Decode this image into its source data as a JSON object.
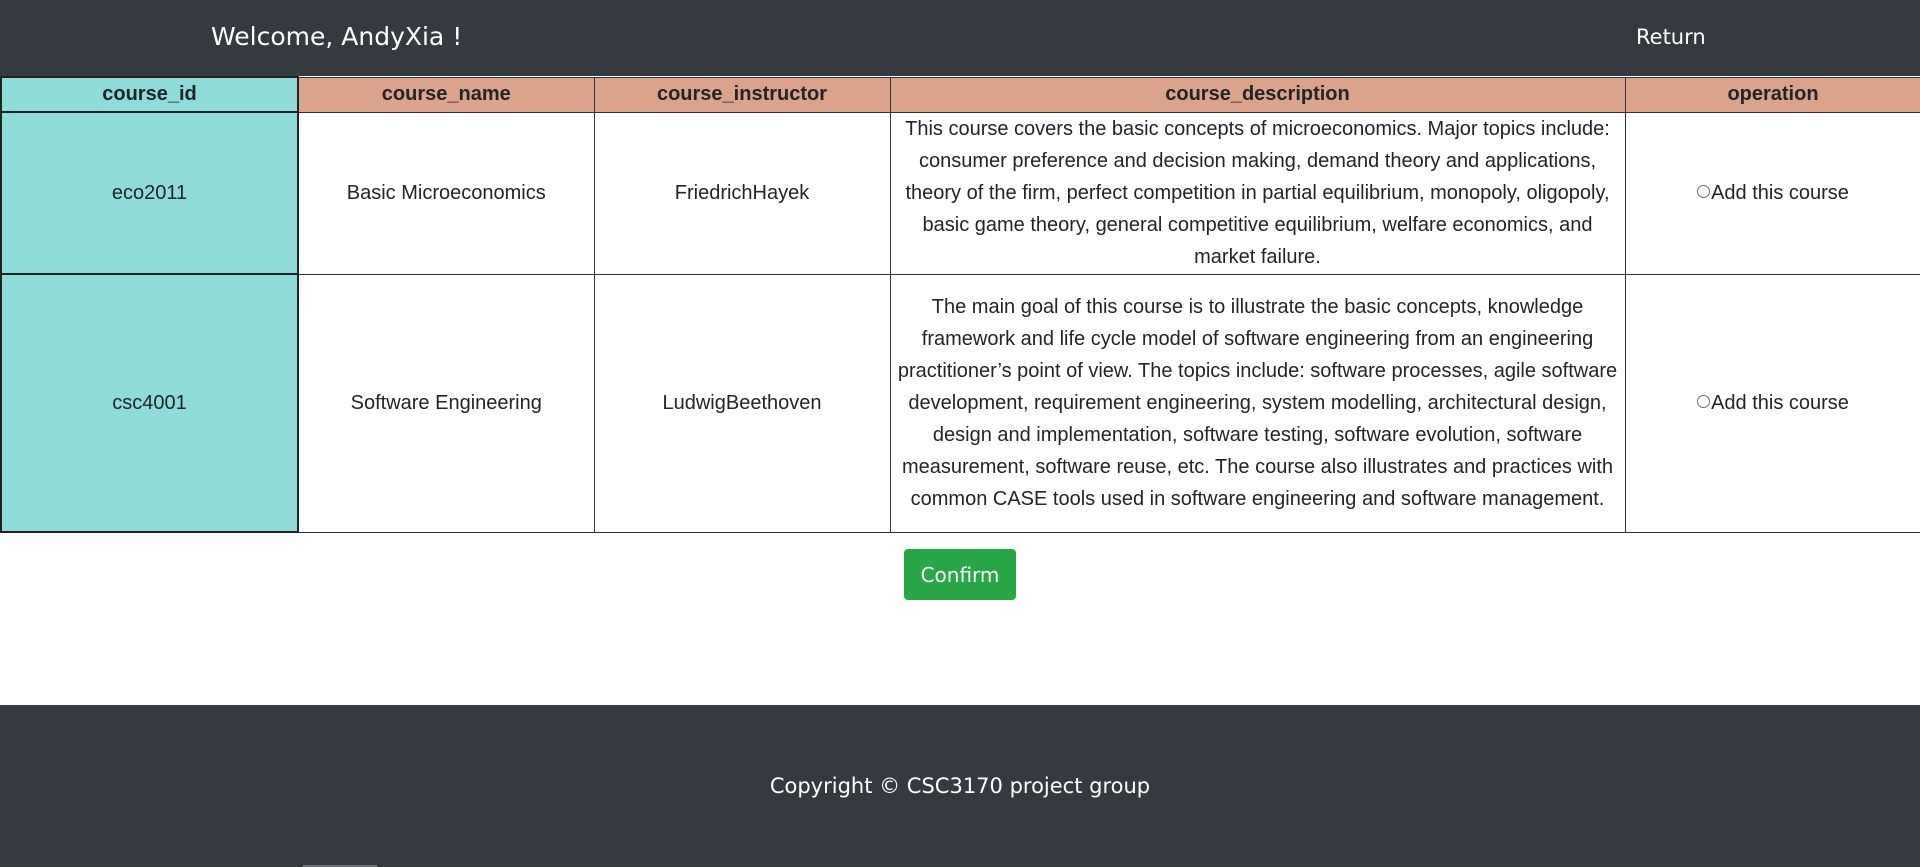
{
  "header": {
    "welcome": "Welcome, AndyXia !",
    "return_label": "Return"
  },
  "table": {
    "columns": [
      "course_id",
      "course_name",
      "course_instructor",
      "course_description",
      "operation"
    ],
    "rows": [
      {
        "course_id": "eco2011",
        "course_name": "Basic Microeconomics",
        "course_instructor": "FriedrichHayek",
        "course_description": "This course covers the basic concepts of microeconomics. Major topics include: consumer preference and decision making, demand theory and applications, theory of the firm, perfect competition in partial equilibrium, monopoly, oligopoly, basic game theory, general competitive equilibrium, welfare economics, and market failure.",
        "operation": "Add this course",
        "selected": false
      },
      {
        "course_id": "csc4001",
        "course_name": "Software Engineering",
        "course_instructor": "LudwigBeethoven",
        "course_description": "The main goal of this course is to illustrate the basic concepts, knowledge framework and life cycle model of software engineering from an engineering practitioner’s point of view. The topics include: software processes, agile software development, requirement engineering, system modelling, architectural design, design and implementation, software testing, software evolution, software measurement, software reuse, etc. The course also illustrates and practices with common CASE tools used in software engineering and software management.",
        "operation": "Add this course",
        "selected": false
      }
    ]
  },
  "confirm_label": "Confirm",
  "footer": {
    "copyright": "Copyright © CSC3170 project group"
  },
  "colors": {
    "navbar": "#343a40",
    "header_cell": "#d9a489",
    "id_column": "#8fdbd9",
    "confirm_button": "#28a745"
  }
}
